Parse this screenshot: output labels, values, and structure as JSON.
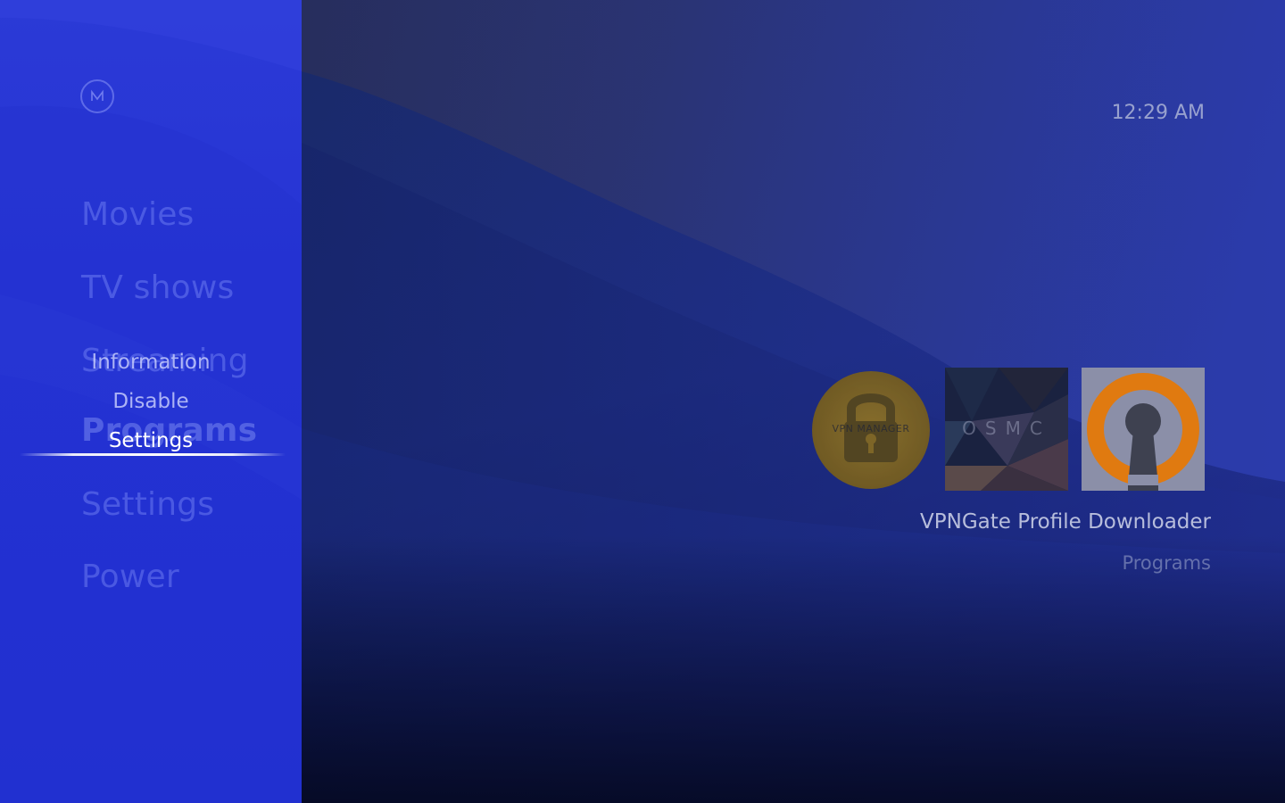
{
  "clock": {
    "time": "12:29 AM"
  },
  "sidebar": {
    "logo_icon": "osmc-logo-icon",
    "menu": [
      {
        "label": "Movies"
      },
      {
        "label": "TV shows"
      },
      {
        "label": "Streaming"
      },
      {
        "label": "Programs"
      },
      {
        "label": "Settings"
      },
      {
        "label": "Power"
      }
    ],
    "context_menu": [
      {
        "label": "Information"
      },
      {
        "label": "Disable"
      },
      {
        "label": "Settings"
      }
    ]
  },
  "addons": {
    "tiles": [
      {
        "name": "vpn-manager",
        "label": "VPN MANAGER",
        "icon": "lock-icon",
        "color": "#9a7a1e"
      },
      {
        "name": "osmc",
        "label": "OSMC",
        "color": "#1a2240"
      },
      {
        "name": "openvpn",
        "icon": "keyhole-icon",
        "color": "#e07a10"
      }
    ],
    "focused_title": "VPNGate Profile Downloader",
    "focused_category": "Programs"
  },
  "colors": {
    "sidebar": "#2533d4",
    "focus_line": "#ffffff",
    "accent_orange": "#e07a10"
  }
}
